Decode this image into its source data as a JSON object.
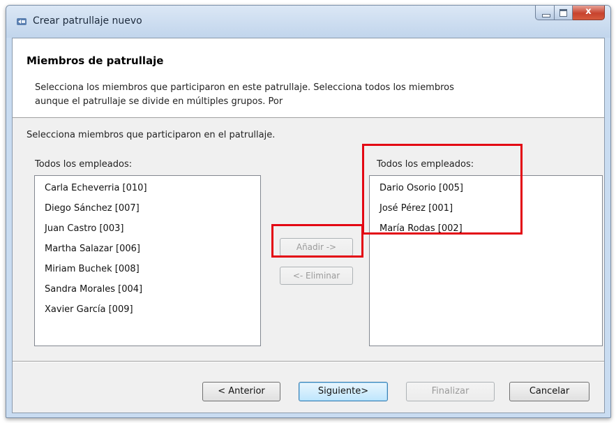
{
  "window": {
    "title": "Crear patrullaje nuevo",
    "close_glyph": "x"
  },
  "header": {
    "title": "Miembros de patrullaje",
    "description": "Selecciona los miembros que participaron en este patrullaje. Selecciona todos los miembros aunque el patrullaje se divide en múltiples grupos. Por"
  },
  "instruction": "Selecciona miembros que participaron en el patrullaje.",
  "left_list": {
    "label": "Todos los empleados:",
    "items": [
      "Carla Echeverria [010]",
      "Diego Sánchez [007]",
      "Juan Castro [003]",
      "Martha Salazar [006]",
      "Miriam Buchek [008]",
      "Sandra Morales [004]",
      "Xavier García [009]"
    ]
  },
  "right_list": {
    "label": "Todos los empleados:",
    "items": [
      "Dario Osorio [005]",
      "José Pérez [001]",
      "María Rodas [002]"
    ]
  },
  "buttons": {
    "add": "Añadir ->",
    "remove": "<- Eliminar",
    "back": "< Anterior",
    "next": "Siguiente>",
    "finish": "Finalizar",
    "cancel": "Cancelar"
  },
  "colors": {
    "highlight": "#e30613",
    "accent": "#3c7fb1"
  },
  "icons": {
    "app": "patrol-app-icon",
    "minimize": "minimize-icon",
    "maximize": "maximize-icon",
    "close": "close-icon"
  }
}
